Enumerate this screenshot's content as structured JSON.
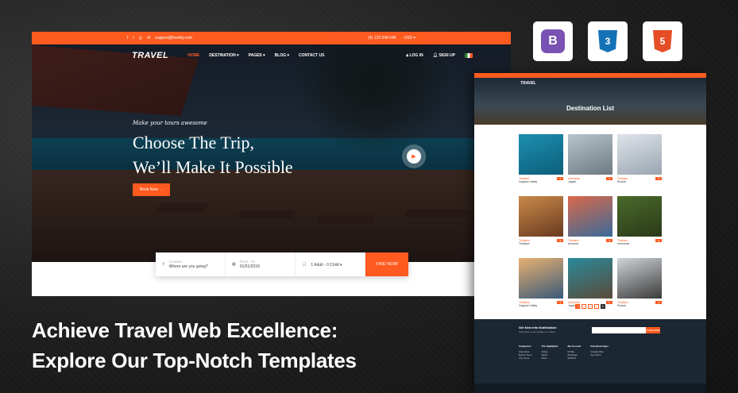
{
  "main": {
    "topbar": {
      "email": "support@bookly.com",
      "phone": "(4) 123 548 546",
      "currency": "USD"
    },
    "nav": {
      "logo": "TRAVEL",
      "items": [
        "HOME",
        "DESTINATION",
        "PAGES",
        "BLOG",
        "CONTACT US"
      ],
      "login": "LOG IN",
      "signup": "SIGN UP"
    },
    "hero": {
      "script": "Make your tours awesome",
      "title_line1": "Choose The Trip,",
      "title_line2": "We’ll Make It Possible",
      "book_now": "Book Now"
    },
    "search": {
      "location_label": "Location",
      "location_placeholder": "Where are you going?",
      "date_label": "From - To",
      "date_value": "01/01/2018",
      "guests": "1 Adult - 0 Child",
      "button": "FIND NOW"
    }
  },
  "tech_badges": [
    {
      "name": "bootstrap",
      "letter": "B",
      "color": "#7952b3"
    },
    {
      "name": "css3",
      "letter": "3",
      "color": "#1572b6"
    },
    {
      "name": "html5",
      "letter": "5",
      "color": "#e44d26"
    }
  ],
  "secondary": {
    "logo": "TRAVEL",
    "title": "Destination List",
    "cards": [
      {
        "country": "Thailand",
        "name": "Cappian Valley",
        "c1": "#1e8fb0",
        "c2": "#0b5e7a"
      },
      {
        "country": "Indonesia",
        "name": "Jayani",
        "c1": "#b8c4cc",
        "c2": "#6d7a82"
      },
      {
        "country": "Thailand",
        "name": "Russia",
        "c1": "#dfe4ea",
        "c2": "#9aa5b0"
      },
      {
        "country": "Thailand",
        "name": "Thailand",
        "c1": "#c98a4a",
        "c2": "#6a3a20"
      },
      {
        "country": "Thailand",
        "name": "Armenia",
        "c1": "#d9694a",
        "c2": "#3a6a9a"
      },
      {
        "country": "Thailand",
        "name": "Indonesia",
        "c1": "#4a6a2a",
        "c2": "#2a3a1a"
      },
      {
        "country": "Thailand",
        "name": "Cappian Valley",
        "c1": "#e8b070",
        "c2": "#3a5a7a"
      },
      {
        "country": "Indonesia",
        "name": "Jayani",
        "c1": "#2a8a9a",
        "c2": "#5a4a3a"
      },
      {
        "country": "Thailand",
        "name": "Russia",
        "c1": "#d0d4d8",
        "c2": "#3a3a3a"
      }
    ],
    "pager": [
      "1",
      "2",
      "3",
      "4",
      "5"
    ],
    "newsletter": "Get New Info Notification",
    "newsletter_sub": "Subscribe to get updates on offers",
    "subscribe": "SUBSCRIBE",
    "footer_cols": [
      {
        "title": "Categories",
        "items": [
          "Adventure",
          "Beach Tours",
          "City Tours"
        ]
      },
      {
        "title": "The Highlights",
        "items": [
          "Dubai",
          "Berlin",
          "Paris"
        ]
      },
      {
        "title": "My Account",
        "items": [
          "Profile",
          "Bookings",
          "Wishlist"
        ]
      },
      {
        "title": "Download Apps",
        "items": [
          "Google Play",
          "App Store"
        ]
      }
    ]
  },
  "headline": {
    "line1": "Achieve Travel Web Excellence:",
    "line2": "Explore Our Top-Notch Templates"
  }
}
